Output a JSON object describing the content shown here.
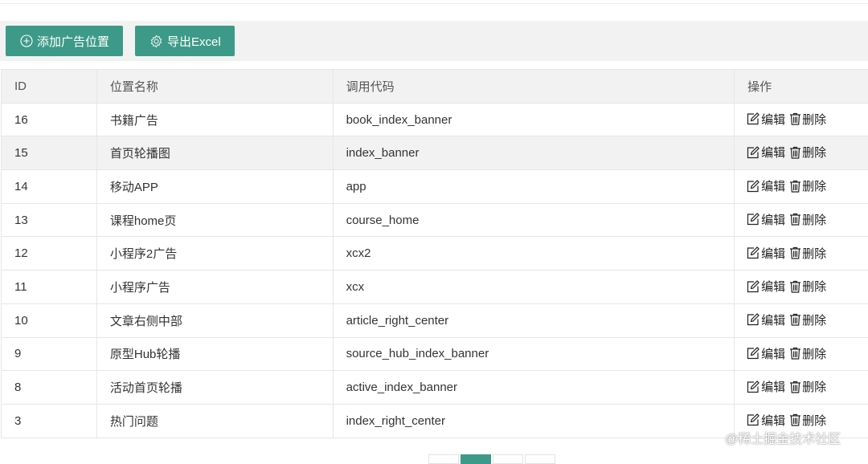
{
  "toolbar": {
    "add_label": "添加广告位置",
    "export_label": "导出Excel"
  },
  "table": {
    "headers": [
      "ID",
      "位置名称",
      "调用代码",
      "操作"
    ],
    "rows": [
      {
        "id": "16",
        "name": "书籍广告",
        "code": "book_index_banner"
      },
      {
        "id": "15",
        "name": "首页轮播图",
        "code": "index_banner"
      },
      {
        "id": "14",
        "name": "移动APP",
        "code": "app"
      },
      {
        "id": "13",
        "name": "课程home页",
        "code": "course_home"
      },
      {
        "id": "12",
        "name": "小程序2广告",
        "code": "xcx2"
      },
      {
        "id": "11",
        "name": "小程序广告",
        "code": "xcx"
      },
      {
        "id": "10",
        "name": "文章右侧中部",
        "code": "article_right_center"
      },
      {
        "id": "9",
        "name": "原型Hub轮播",
        "code": "source_hub_index_banner"
      },
      {
        "id": "8",
        "name": "活动首页轮播",
        "code": "active_index_banner"
      },
      {
        "id": "3",
        "name": "热门问题",
        "code": "index_right_center"
      }
    ],
    "edit_label": "编辑",
    "delete_label": "删除",
    "highlighted_row": 1
  },
  "pagination": {
    "active_page": 2
  },
  "watermark": "@稀土掘金技术社区",
  "colors": {
    "accent": "#3d9a88",
    "header_bg": "#f2f2f2"
  }
}
